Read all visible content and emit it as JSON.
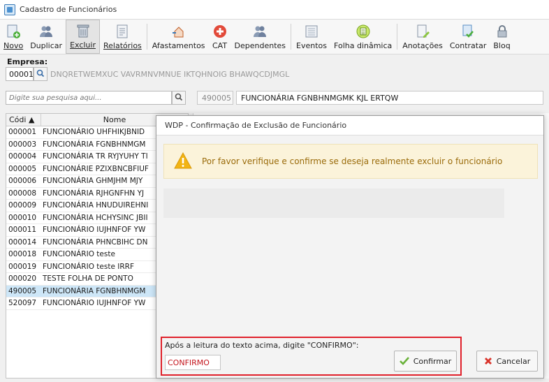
{
  "window": {
    "title": "Cadastro de Funcionários"
  },
  "toolbar": {
    "buttons": [
      {
        "label": "Novo",
        "icon": "new-document-icon"
      },
      {
        "label": "Duplicar",
        "icon": "users-icon"
      },
      {
        "label": "Excluir",
        "icon": "trash-icon"
      },
      {
        "label": "Relatórios",
        "icon": "report-icon"
      },
      {
        "label": "Afastamentos",
        "icon": "home-arrow-icon"
      },
      {
        "label": "CAT",
        "icon": "red-cross-icon"
      },
      {
        "label": "Dependentes",
        "icon": "users-icon"
      },
      {
        "label": "Eventos",
        "icon": "list-icon"
      },
      {
        "label": "Folha dinâmica",
        "icon": "calculator-icon"
      },
      {
        "label": "Anotações",
        "icon": "document-edit-icon"
      },
      {
        "label": "Contratar",
        "icon": "contract-check-icon"
      },
      {
        "label": "Bloq",
        "icon": "lock-icon"
      }
    ]
  },
  "empresa": {
    "label": "Empresa:",
    "code": "00001",
    "name": "DNQRETWEMXUC VAVRMNVMNUE IKTQHNOIG BHAWQCDJMGL"
  },
  "search": {
    "placeholder": "Digite sua pesquisa aqui..."
  },
  "selected": {
    "code": "490005",
    "name": "FUNCIONÁRIA FGNBHNMGMK KJL ERTQW"
  },
  "table": {
    "headers": {
      "code": "Códi ▲",
      "name": "Nome"
    },
    "rows": [
      {
        "code": "000001",
        "name": "FUNCIONÁRIO UHFHIKJBNID"
      },
      {
        "code": "000003",
        "name": "FUNCIONÁRIA FGNBHNMGM"
      },
      {
        "code": "000004",
        "name": "FUNCIONÁRIA TR RYJYUHY TI"
      },
      {
        "code": "000005",
        "name": "FUNCIONÁRIE PZIXBNCBFIUF"
      },
      {
        "code": "000006",
        "name": "FUNCIONÁRIA GHMJHM MJY"
      },
      {
        "code": "000008",
        "name": "FUNCIONÁRIA RJHGNFHN YJ"
      },
      {
        "code": "000009",
        "name": "FUNCIONÁRIA HNUDUIREHNI"
      },
      {
        "code": "000010",
        "name": "FUNCIONÁRIA HCHYSINC JBII"
      },
      {
        "code": "000011",
        "name": "FUNCIONÁRIO IUJHNFOF YW"
      },
      {
        "code": "000014",
        "name": "FUNCIONÁRIA PHNCBIHC DN"
      },
      {
        "code": "000018",
        "name": "FUNCIONÁRIO teste"
      },
      {
        "code": "000019",
        "name": "FUNCIONÁRIO teste IRRF"
      },
      {
        "code": "000020",
        "name": "TESTE FOLHA DE PONTO"
      },
      {
        "code": "490005",
        "name": "FUNCIONÁRIA FGNBHNMGM"
      },
      {
        "code": "520097",
        "name": "FUNCIONÁRIO IUJHNFOF YW"
      }
    ],
    "selected_index": 13
  },
  "dialog": {
    "title": "WDP - Confirmação de Exclusão de Funcionário",
    "warning": "Por favor verifique e confirme se deseja realmente excluir o funcionário",
    "confirm_prompt": "Após a leitura do texto acima, digite \"CONFIRMO\":",
    "confirm_value": "CONFIRMO",
    "confirm_button": "Confirmar",
    "cancel_button": "Cancelar"
  },
  "colors": {
    "accent_red": "#e0202a",
    "warning_bg": "#fbf3da",
    "warning_text": "#9a6b0a",
    "selection": "#cde6f7"
  }
}
